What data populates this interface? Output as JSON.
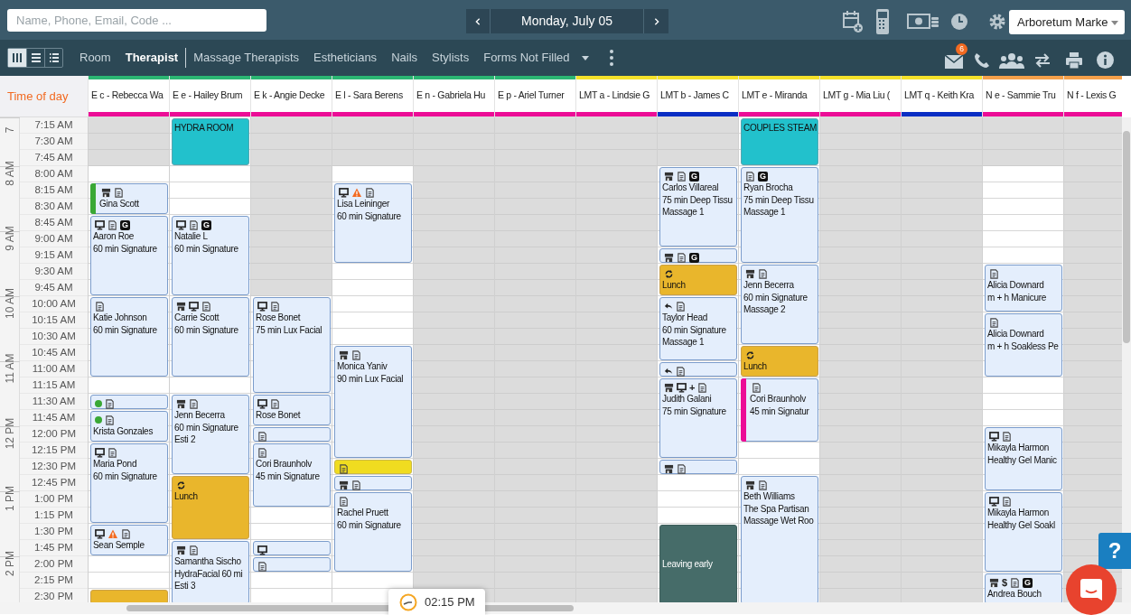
{
  "top_bar": {
    "search": {
      "placeholder": "Name, Phone, Email, Code ..."
    },
    "date": "Monday, July 05",
    "location": "Arboretum Marke"
  },
  "nav_bar": {
    "view_modes": [
      {
        "kind": "columns",
        "selected": true
      },
      {
        "kind": "rows",
        "selected": false
      },
      {
        "kind": "list",
        "selected": false
      }
    ],
    "tabs": [
      {
        "label": "Room",
        "selected": false
      },
      {
        "label": "Therapist",
        "selected": true
      },
      {
        "label": "Massage Therapists",
        "selected": false
      },
      {
        "label": "Estheticians",
        "selected": false
      },
      {
        "label": "Nails",
        "selected": false
      },
      {
        "label": "Stylists",
        "selected": false
      },
      {
        "label": "Forms Not Filled",
        "selected": false
      }
    ],
    "message_count": "6"
  },
  "time_header": "Time of day",
  "hours": [
    "7",
    "8 AM",
    "9 AM",
    "10 AM",
    "11 AM",
    "12 PM",
    "1 PM",
    "2 PM"
  ],
  "times": [
    "7:15 AM",
    "7:30 AM",
    "7:45 AM",
    "8:00 AM",
    "8:15 AM",
    "8:30 AM",
    "8:45 AM",
    "9:00 AM",
    "9:15 AM",
    "9:30 AM",
    "9:45 AM",
    "10:00 AM",
    "10:15 AM",
    "10:30 AM",
    "10:45 AM",
    "11:00 AM",
    "11:15 AM",
    "11:30 AM",
    "11:45 AM",
    "12:00 PM",
    "12:15 PM",
    "12:30 PM",
    "12:45 PM",
    "1:00 PM",
    "1:15 PM",
    "1:30 PM",
    "1:45 PM",
    "2:00 PM",
    "2:15 PM",
    "2:30 PM"
  ],
  "columns": [
    {
      "name": "E c - Rebecca Wa",
      "top_strip": {
        "color": "#2bb673"
      },
      "bottom_strip": {
        "color": "#ec0d96"
      },
      "slots": [
        {
          "kind": "closed"
        },
        {
          "kind": "closed"
        },
        {
          "kind": "closed"
        },
        {
          "kind": "open"
        },
        {
          "kind": "booking",
          "color": "#3aa835",
          "badges": [
            {
              "kind": "store"
            },
            {
              "kind": "note"
            }
          ],
          "lines": [
            "Gina Scott"
          ]
        },
        {
          "kind": "more"
        },
        {
          "kind": "booking",
          "badges": [
            {
              "kind": "monitor"
            },
            {
              "kind": "note"
            },
            {
              "kind": "letter",
              "text": "G"
            }
          ],
          "lines": [
            "Aaron Roe",
            "60 min Signature"
          ]
        },
        {
          "kind": "more"
        },
        {
          "kind": "more"
        },
        {
          "kind": "more"
        },
        {
          "kind": "more"
        },
        {
          "kind": "booking",
          "badges": [
            {
              "kind": "note"
            }
          ],
          "lines": [
            "Katie Johnson",
            "60 min Signature"
          ]
        },
        {
          "kind": "more"
        },
        {
          "kind": "more"
        },
        {
          "kind": "more"
        },
        {
          "kind": "more"
        },
        {
          "kind": "open"
        },
        {
          "kind": "booking",
          "badges": [
            {
              "kind": "dot",
              "color": "#3aa835"
            },
            {
              "kind": "note"
            }
          ]
        },
        {
          "kind": "booking",
          "badges": [
            {
              "kind": "dot",
              "color": "#3aa835"
            },
            {
              "kind": "note"
            }
          ],
          "lines": [
            "Krista Gonzales"
          ]
        },
        {
          "kind": "more"
        },
        {
          "kind": "booking",
          "badges": [
            {
              "kind": "monitor"
            },
            {
              "kind": "note"
            }
          ],
          "lines": [
            "Maria Pond",
            "60 min Signature"
          ]
        },
        {
          "kind": "more"
        },
        {
          "kind": "more"
        },
        {
          "kind": "more"
        },
        {
          "kind": "more"
        },
        {
          "kind": "booking",
          "badges": [
            {
              "kind": "monitor"
            },
            {
              "kind": "warning"
            },
            {
              "kind": "note"
            }
          ],
          "lines": [
            "Sean Semple"
          ]
        },
        {
          "kind": "more"
        },
        {
          "kind": "open"
        },
        {
          "kind": "open"
        },
        {
          "kind": "break"
        }
      ]
    },
    {
      "name": "E e - Hailey Brum",
      "top_strip": {
        "color": "#2bb673"
      },
      "bottom_strip": {
        "color": "#ec0d96"
      },
      "slots": [
        {
          "kind": "room",
          "lines": [
            "HYDRA ROOM"
          ]
        },
        {
          "kind": "more"
        },
        {
          "kind": "more"
        },
        {
          "kind": "open"
        },
        {
          "kind": "open"
        },
        {
          "kind": "open"
        },
        {
          "kind": "booking",
          "badges": [
            {
              "kind": "monitor"
            },
            {
              "kind": "note"
            },
            {
              "kind": "letter",
              "text": "G"
            }
          ],
          "lines": [
            "Natalie L",
            "60 min Signature"
          ]
        },
        {
          "kind": "more"
        },
        {
          "kind": "more"
        },
        {
          "kind": "more"
        },
        {
          "kind": "more"
        },
        {
          "kind": "booking",
          "badges": [
            {
              "kind": "store"
            },
            {
              "kind": "monitor"
            },
            {
              "kind": "note"
            }
          ],
          "lines": [
            "Carrie Scott",
            "60 min Signature"
          ]
        },
        {
          "kind": "more"
        },
        {
          "kind": "more"
        },
        {
          "kind": "more"
        },
        {
          "kind": "more"
        },
        {
          "kind": "open"
        },
        {
          "kind": "booking",
          "badges": [
            {
              "kind": "store"
            },
            {
              "kind": "note"
            }
          ],
          "lines": [
            "Jenn Becerra",
            "60 min Signature",
            "Esti 2"
          ]
        },
        {
          "kind": "more"
        },
        {
          "kind": "more"
        },
        {
          "kind": "more"
        },
        {
          "kind": "more"
        },
        {
          "kind": "break",
          "badges": [
            {
              "kind": "refresh"
            }
          ],
          "lines": [
            "Lunch"
          ]
        },
        {
          "kind": "more"
        },
        {
          "kind": "more"
        },
        {
          "kind": "more"
        },
        {
          "kind": "booking",
          "badges": [
            {
              "kind": "store"
            },
            {
              "kind": "note"
            }
          ],
          "lines": [
            "Samantha Sischo",
            "HydraFacial 60 mi",
            "Esti 3"
          ]
        },
        {
          "kind": "more"
        },
        {
          "kind": "more"
        },
        {
          "kind": "more"
        }
      ]
    },
    {
      "name": "E k - Angie Decke",
      "top_strip": {
        "color": "#2bb673"
      },
      "bottom_strip": {
        "color": "#ec0d96"
      },
      "slots": [
        {
          "kind": "closed"
        },
        {
          "kind": "closed"
        },
        {
          "kind": "closed"
        },
        {
          "kind": "closed"
        },
        {
          "kind": "closed"
        },
        {
          "kind": "closed"
        },
        {
          "kind": "closed"
        },
        {
          "kind": "closed"
        },
        {
          "kind": "closed"
        },
        {
          "kind": "closed"
        },
        {
          "kind": "closed"
        },
        {
          "kind": "booking",
          "badges": [
            {
              "kind": "monitor"
            },
            {
              "kind": "note"
            }
          ],
          "lines": [
            "Rose Bonet",
            "75 min Lux Facial"
          ]
        },
        {
          "kind": "more"
        },
        {
          "kind": "more"
        },
        {
          "kind": "more"
        },
        {
          "kind": "more"
        },
        {
          "kind": "more"
        },
        {
          "kind": "booking",
          "badges": [
            {
              "kind": "monitor"
            },
            {
              "kind": "note"
            }
          ],
          "lines": [
            "Rose Bonet"
          ]
        },
        {
          "kind": "more"
        },
        {
          "kind": "booking",
          "badges": [
            {
              "kind": "note"
            }
          ]
        },
        {
          "kind": "booking",
          "badges": [
            {
              "kind": "note"
            }
          ],
          "lines": [
            "Cori Braunholv",
            "45 min Signature"
          ]
        },
        {
          "kind": "more"
        },
        {
          "kind": "more"
        },
        {
          "kind": "more"
        },
        {
          "kind": "open"
        },
        {
          "kind": "open"
        },
        {
          "kind": "booking",
          "badges": [
            {
              "kind": "monitor"
            }
          ]
        },
        {
          "kind": "booking",
          "badges": [
            {
              "kind": "note"
            }
          ]
        },
        {
          "kind": "open"
        },
        {
          "kind": "open"
        }
      ]
    },
    {
      "name": "E l - Sara Berens",
      "top_strip": {
        "color": "#2bb673"
      },
      "bottom_strip": {
        "color": "#ec0d96"
      },
      "slots": [
        {
          "kind": "closed"
        },
        {
          "kind": "closed"
        },
        {
          "kind": "closed"
        },
        {
          "kind": "open"
        },
        {
          "kind": "booking",
          "badges": [
            {
              "kind": "monitor"
            },
            {
              "kind": "warning"
            },
            {
              "kind": "note"
            }
          ],
          "lines": [
            "Lisa Leininger",
            "60 min Signature"
          ]
        },
        {
          "kind": "more"
        },
        {
          "kind": "more"
        },
        {
          "kind": "more"
        },
        {
          "kind": "more"
        },
        {
          "kind": "open"
        },
        {
          "kind": "open"
        },
        {
          "kind": "open"
        },
        {
          "kind": "open"
        },
        {
          "kind": "open"
        },
        {
          "kind": "booking",
          "badges": [
            {
              "kind": "store"
            },
            {
              "kind": "note"
            }
          ],
          "lines": [
            "Monica Yaniv",
            "90 min Lux Facial"
          ]
        },
        {
          "kind": "more"
        },
        {
          "kind": "more"
        },
        {
          "kind": "more"
        },
        {
          "kind": "more"
        },
        {
          "kind": "more"
        },
        {
          "kind": "more"
        },
        {
          "kind": "hold",
          "badges": [
            {
              "kind": "note"
            }
          ]
        },
        {
          "kind": "booking",
          "badges": [
            {
              "kind": "store"
            },
            {
              "kind": "note"
            }
          ]
        },
        {
          "kind": "booking",
          "badges": [
            {
              "kind": "note"
            }
          ],
          "lines": [
            "Rachel Pruett",
            "60 min Signature"
          ]
        },
        {
          "kind": "more"
        },
        {
          "kind": "more"
        },
        {
          "kind": "more"
        },
        {
          "kind": "more"
        },
        {
          "kind": "open"
        },
        {
          "kind": "open"
        }
      ]
    },
    {
      "name": "E n - Gabriela Hu",
      "top_strip": {
        "color": "#2bb673"
      },
      "bottom_strip": {
        "color": "#ec0d96"
      },
      "slots": [
        {
          "kind": "closed"
        },
        {
          "kind": "closed"
        },
        {
          "kind": "closed"
        },
        {
          "kind": "closed"
        },
        {
          "kind": "closed"
        },
        {
          "kind": "closed"
        },
        {
          "kind": "closed"
        },
        {
          "kind": "closed"
        },
        {
          "kind": "closed"
        },
        {
          "kind": "closed"
        },
        {
          "kind": "closed"
        },
        {
          "kind": "closed"
        },
        {
          "kind": "closed"
        },
        {
          "kind": "closed"
        },
        {
          "kind": "closed"
        },
        {
          "kind": "closed"
        },
        {
          "kind": "closed"
        },
        {
          "kind": "closed"
        },
        {
          "kind": "closed"
        },
        {
          "kind": "closed"
        },
        {
          "kind": "closed"
        },
        {
          "kind": "closed"
        },
        {
          "kind": "closed"
        },
        {
          "kind": "closed"
        },
        {
          "kind": "closed"
        },
        {
          "kind": "closed"
        },
        {
          "kind": "closed"
        },
        {
          "kind": "closed"
        },
        {
          "kind": "closed"
        },
        {
          "kind": "closed"
        }
      ]
    },
    {
      "name": "E p - Ariel Turner",
      "top_strip": {
        "color": "#2bb673"
      },
      "bottom_strip": {
        "color": "#ec0d96"
      },
      "slots": [
        {
          "kind": "closed"
        },
        {
          "kind": "closed"
        },
        {
          "kind": "closed"
        },
        {
          "kind": "closed"
        },
        {
          "kind": "closed"
        },
        {
          "kind": "closed"
        },
        {
          "kind": "closed"
        },
        {
          "kind": "closed"
        },
        {
          "kind": "closed"
        },
        {
          "kind": "closed"
        },
        {
          "kind": "closed"
        },
        {
          "kind": "closed"
        },
        {
          "kind": "closed"
        },
        {
          "kind": "closed"
        },
        {
          "kind": "closed"
        },
        {
          "kind": "closed"
        },
        {
          "kind": "closed"
        },
        {
          "kind": "closed"
        },
        {
          "kind": "closed"
        },
        {
          "kind": "closed"
        },
        {
          "kind": "closed"
        },
        {
          "kind": "closed"
        },
        {
          "kind": "closed"
        },
        {
          "kind": "closed"
        },
        {
          "kind": "closed"
        },
        {
          "kind": "closed"
        },
        {
          "kind": "closed"
        },
        {
          "kind": "closed"
        },
        {
          "kind": "closed"
        },
        {
          "kind": "closed"
        }
      ]
    },
    {
      "name": "LMT a - Lindsie G",
      "top_strip": {
        "color": "#f5e12a"
      },
      "bottom_strip": {
        "color": "#ec0d96"
      },
      "slots": [
        {
          "kind": "closed"
        },
        {
          "kind": "closed"
        },
        {
          "kind": "closed"
        },
        {
          "kind": "closed"
        },
        {
          "kind": "closed"
        },
        {
          "kind": "closed"
        },
        {
          "kind": "closed"
        },
        {
          "kind": "closed"
        },
        {
          "kind": "closed"
        },
        {
          "kind": "closed"
        },
        {
          "kind": "closed"
        },
        {
          "kind": "closed"
        },
        {
          "kind": "closed"
        },
        {
          "kind": "closed"
        },
        {
          "kind": "closed"
        },
        {
          "kind": "closed"
        },
        {
          "kind": "closed"
        },
        {
          "kind": "closed"
        },
        {
          "kind": "closed"
        },
        {
          "kind": "closed"
        },
        {
          "kind": "closed"
        },
        {
          "kind": "closed"
        },
        {
          "kind": "closed"
        },
        {
          "kind": "closed"
        },
        {
          "kind": "closed"
        },
        {
          "kind": "closed"
        },
        {
          "kind": "closed"
        },
        {
          "kind": "closed"
        },
        {
          "kind": "closed"
        },
        {
          "kind": "closed"
        }
      ]
    },
    {
      "name": "LMT b - James C",
      "top_strip": {
        "color": "#f5e12a"
      },
      "bottom_strip": {
        "color": "#0a2ec4"
      },
      "slots": [
        {
          "kind": "closed"
        },
        {
          "kind": "closed"
        },
        {
          "kind": "closed"
        },
        {
          "kind": "booking",
          "badges": [
            {
              "kind": "store"
            },
            {
              "kind": "note"
            },
            {
              "kind": "letter",
              "text": "G"
            }
          ],
          "lines": [
            "Carlos Villareal",
            "75 min Deep Tissu",
            "Massage 1"
          ]
        },
        {
          "kind": "more"
        },
        {
          "kind": "more"
        },
        {
          "kind": "more"
        },
        {
          "kind": "more"
        },
        {
          "kind": "booking",
          "badges": [
            {
              "kind": "store"
            },
            {
              "kind": "note"
            },
            {
              "kind": "letter",
              "text": "G"
            }
          ]
        },
        {
          "kind": "break",
          "badges": [
            {
              "kind": "refresh"
            }
          ],
          "lines": [
            "Lunch"
          ]
        },
        {
          "kind": "more"
        },
        {
          "kind": "booking",
          "badges": [
            {
              "kind": "reply"
            },
            {
              "kind": "note"
            }
          ],
          "lines": [
            "Taylor Head",
            "60 min Signature",
            "Massage 1"
          ]
        },
        {
          "kind": "more"
        },
        {
          "kind": "more"
        },
        {
          "kind": "more"
        },
        {
          "kind": "booking",
          "badges": [
            {
              "kind": "reply"
            },
            {
              "kind": "note"
            }
          ]
        },
        {
          "kind": "booking",
          "badges": [
            {
              "kind": "store"
            },
            {
              "kind": "monitor"
            },
            {
              "kind": "symbol",
              "text": "+"
            },
            {
              "kind": "note"
            }
          ],
          "lines": [
            "Judith Galani",
            "75 min Signature"
          ]
        },
        {
          "kind": "more"
        },
        {
          "kind": "more"
        },
        {
          "kind": "more"
        },
        {
          "kind": "more"
        },
        {
          "kind": "booking",
          "badges": [
            {
              "kind": "store"
            },
            {
              "kind": "note"
            }
          ]
        },
        {
          "kind": "open"
        },
        {
          "kind": "open"
        },
        {
          "kind": "open"
        },
        {
          "kind": "time_off",
          "lines": [
            "Leaving early"
          ]
        },
        {
          "kind": "more"
        },
        {
          "kind": "more"
        },
        {
          "kind": "more"
        },
        {
          "kind": "more"
        }
      ]
    },
    {
      "name": "LMT e - Miranda",
      "top_strip": {
        "color": "#f5e12a"
      },
      "bottom_strip": {
        "color": "#ec0d96"
      },
      "slots": [
        {
          "kind": "room",
          "lines": [
            "COUPLES STEAM"
          ]
        },
        {
          "kind": "more"
        },
        {
          "kind": "more"
        },
        {
          "kind": "booking",
          "badges": [
            {
              "kind": "note"
            },
            {
              "kind": "letter",
              "text": "G"
            }
          ],
          "lines": [
            "Ryan Brocha",
            "75 min Deep Tissu",
            "Massage 1"
          ]
        },
        {
          "kind": "more"
        },
        {
          "kind": "more"
        },
        {
          "kind": "more"
        },
        {
          "kind": "more"
        },
        {
          "kind": "more"
        },
        {
          "kind": "booking",
          "badges": [
            {
              "kind": "store"
            },
            {
              "kind": "note"
            }
          ],
          "lines": [
            "Jenn Becerra",
            "60 min Signature",
            "Massage 2"
          ]
        },
        {
          "kind": "more"
        },
        {
          "kind": "more"
        },
        {
          "kind": "more"
        },
        {
          "kind": "more"
        },
        {
          "kind": "break",
          "badges": [
            {
              "kind": "refresh"
            }
          ],
          "lines": [
            "Lunch"
          ]
        },
        {
          "kind": "more"
        },
        {
          "kind": "booking",
          "color": "#ec0d96",
          "badges": [
            {
              "kind": "note"
            }
          ],
          "lines": [
            "Cori Braunholv",
            "45 min Signatur"
          ]
        },
        {
          "kind": "more"
        },
        {
          "kind": "more"
        },
        {
          "kind": "more"
        },
        {
          "kind": "open"
        },
        {
          "kind": "open"
        },
        {
          "kind": "booking",
          "badges": [
            {
              "kind": "store"
            },
            {
              "kind": "note"
            }
          ],
          "lines": [
            "Beth Williams",
            "The Spa Partisan",
            "Massage Wet Roo"
          ]
        },
        {
          "kind": "more"
        },
        {
          "kind": "more"
        },
        {
          "kind": "more"
        },
        {
          "kind": "more"
        },
        {
          "kind": "more"
        },
        {
          "kind": "more"
        },
        {
          "kind": "more"
        }
      ]
    },
    {
      "name": "LMT g - Mia Liu (",
      "top_strip": {
        "color": "#f5e12a"
      },
      "bottom_strip": {
        "color": "#ec0d96"
      },
      "slots": [
        {
          "kind": "closed"
        },
        {
          "kind": "closed"
        },
        {
          "kind": "closed"
        },
        {
          "kind": "closed"
        },
        {
          "kind": "closed"
        },
        {
          "kind": "closed"
        },
        {
          "kind": "closed"
        },
        {
          "kind": "closed"
        },
        {
          "kind": "closed"
        },
        {
          "kind": "closed"
        },
        {
          "kind": "closed"
        },
        {
          "kind": "closed"
        },
        {
          "kind": "closed"
        },
        {
          "kind": "closed"
        },
        {
          "kind": "closed"
        },
        {
          "kind": "closed"
        },
        {
          "kind": "closed"
        },
        {
          "kind": "closed"
        },
        {
          "kind": "closed"
        },
        {
          "kind": "closed"
        },
        {
          "kind": "closed"
        },
        {
          "kind": "closed"
        },
        {
          "kind": "closed"
        },
        {
          "kind": "closed"
        },
        {
          "kind": "closed"
        },
        {
          "kind": "closed"
        },
        {
          "kind": "closed"
        },
        {
          "kind": "closed"
        },
        {
          "kind": "closed"
        },
        {
          "kind": "closed"
        }
      ]
    },
    {
      "name": "LMT q - Keith Kra",
      "top_strip": {
        "color": "#f5e12a"
      },
      "bottom_strip": {
        "color": "#0a2ec4"
      },
      "slots": [
        {
          "kind": "closed"
        },
        {
          "kind": "closed"
        },
        {
          "kind": "closed"
        },
        {
          "kind": "closed"
        },
        {
          "kind": "closed"
        },
        {
          "kind": "closed"
        },
        {
          "kind": "closed"
        },
        {
          "kind": "closed"
        },
        {
          "kind": "closed"
        },
        {
          "kind": "closed"
        },
        {
          "kind": "closed"
        },
        {
          "kind": "closed"
        },
        {
          "kind": "closed"
        },
        {
          "kind": "closed"
        },
        {
          "kind": "closed"
        },
        {
          "kind": "closed"
        },
        {
          "kind": "closed"
        },
        {
          "kind": "closed"
        },
        {
          "kind": "closed"
        },
        {
          "kind": "closed"
        },
        {
          "kind": "closed"
        },
        {
          "kind": "closed"
        },
        {
          "kind": "closed"
        },
        {
          "kind": "closed"
        },
        {
          "kind": "closed"
        },
        {
          "kind": "closed"
        },
        {
          "kind": "closed"
        },
        {
          "kind": "closed"
        },
        {
          "kind": "closed"
        },
        {
          "kind": "closed"
        }
      ]
    },
    {
      "name": "N e - Sammie Tru",
      "top_strip": {
        "color": "#f5a04a"
      },
      "bottom_strip": {
        "color": "#ec0d96"
      },
      "slots": [
        {
          "kind": "closed"
        },
        {
          "kind": "closed"
        },
        {
          "kind": "closed"
        },
        {
          "kind": "open"
        },
        {
          "kind": "open"
        },
        {
          "kind": "open"
        },
        {
          "kind": "open"
        },
        {
          "kind": "open"
        },
        {
          "kind": "open"
        },
        {
          "kind": "booking",
          "badges": [
            {
              "kind": "note"
            }
          ],
          "lines": [
            "Alicia Downard",
            "m + h Manicure"
          ]
        },
        {
          "kind": "more"
        },
        {
          "kind": "more"
        },
        {
          "kind": "booking",
          "badges": [
            {
              "kind": "note"
            }
          ],
          "lines": [
            "Alicia Downard",
            "m + h Soakless Pe"
          ]
        },
        {
          "kind": "more"
        },
        {
          "kind": "more"
        },
        {
          "kind": "more"
        },
        {
          "kind": "open"
        },
        {
          "kind": "open"
        },
        {
          "kind": "open"
        },
        {
          "kind": "booking",
          "badges": [
            {
              "kind": "monitor"
            },
            {
              "kind": "note"
            }
          ],
          "lines": [
            "Mikayla Harmon",
            "Healthy Gel Manic"
          ]
        },
        {
          "kind": "more"
        },
        {
          "kind": "more"
        },
        {
          "kind": "more"
        },
        {
          "kind": "booking",
          "badges": [
            {
              "kind": "monitor"
            },
            {
              "kind": "note"
            }
          ],
          "lines": [
            "Mikayla Harmon",
            "Healthy Gel Soakl"
          ]
        },
        {
          "kind": "more"
        },
        {
          "kind": "more"
        },
        {
          "kind": "more"
        },
        {
          "kind": "more"
        },
        {
          "kind": "booking",
          "badges": [
            {
              "kind": "store"
            },
            {
              "kind": "symbol",
              "text": "$"
            },
            {
              "kind": "note"
            },
            {
              "kind": "letter",
              "text": "G"
            }
          ],
          "lines": [
            "Andrea Bouch"
          ]
        },
        {
          "kind": "more"
        }
      ]
    },
    {
      "name": "N f - Lexis G",
      "top_strip": {
        "color": "#f5a04a"
      },
      "bottom_strip": {
        "color": "#ec0d96"
      },
      "slots": [
        {
          "kind": "closed"
        },
        {
          "kind": "closed"
        },
        {
          "kind": "closed"
        },
        {
          "kind": "closed"
        },
        {
          "kind": "closed"
        },
        {
          "kind": "closed"
        },
        {
          "kind": "closed"
        },
        {
          "kind": "closed"
        },
        {
          "kind": "closed"
        },
        {
          "kind": "closed"
        },
        {
          "kind": "closed"
        },
        {
          "kind": "closed"
        },
        {
          "kind": "closed"
        },
        {
          "kind": "closed"
        },
        {
          "kind": "closed"
        },
        {
          "kind": "closed"
        },
        {
          "kind": "closed"
        },
        {
          "kind": "closed"
        },
        {
          "kind": "closed"
        },
        {
          "kind": "closed"
        },
        {
          "kind": "closed"
        },
        {
          "kind": "closed"
        },
        {
          "kind": "closed"
        },
        {
          "kind": "closed"
        },
        {
          "kind": "closed"
        },
        {
          "kind": "closed"
        },
        {
          "kind": "closed"
        },
        {
          "kind": "closed"
        },
        {
          "kind": "closed"
        },
        {
          "kind": "closed"
        }
      ]
    }
  ],
  "current_time": "02:15 PM",
  "help_label": "?"
}
